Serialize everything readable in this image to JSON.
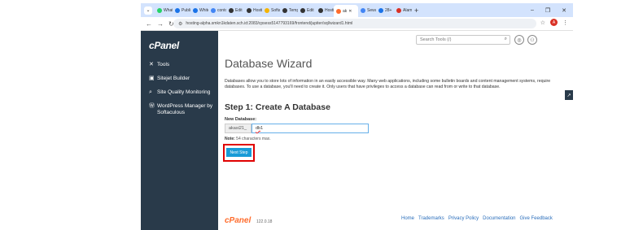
{
  "browser": {
    "tabs": [
      {
        "label": "What",
        "color": "#25d366"
      },
      {
        "label": "Publi",
        "color": "#1a73e8"
      },
      {
        "label": "White",
        "color": "#1a73e8"
      },
      {
        "label": "conto",
        "color": "#4285f4"
      },
      {
        "label": "Edit",
        "color": "#333333"
      },
      {
        "label": "Hosti",
        "color": "#333333"
      },
      {
        "label": "Softa",
        "color": "#f4b400"
      },
      {
        "label": "Temp",
        "color": "#333333"
      },
      {
        "label": "Edit",
        "color": "#333333"
      },
      {
        "label": "Hosti",
        "color": "#333333"
      },
      {
        "label": "ak",
        "color": "#ff6c2c",
        "active": true
      },
      {
        "label": "Sewa",
        "color": "#4285f4"
      },
      {
        "label": "28+",
        "color": "#1a73e8"
      },
      {
        "label": "Alam",
        "color": "#d93025"
      }
    ],
    "new_tab": "+",
    "window_controls": [
      "–",
      "❐",
      "✕"
    ],
    "url": "hosting-alpha.smkn1kdaten.sch.id:2083/cpsess5147793169/frontend/jupiter/sql/wizard1.html",
    "profile_initial": "A"
  },
  "sidebar": {
    "logo": "cPanel",
    "items": [
      {
        "label": "Tools",
        "icon": "tools-icon",
        "glyph": "✕"
      },
      {
        "label": "Sitejet Builder",
        "icon": "sitejet-icon",
        "glyph": "▣"
      },
      {
        "label": "Site Quality Monitoring",
        "icon": "magnifier-icon",
        "glyph": "⌕"
      },
      {
        "label": "WordPress Manager by Softaculous",
        "icon": "wordpress-icon",
        "glyph": "Ⓦ"
      }
    ]
  },
  "header": {
    "search_placeholder": "Search Tools (/)"
  },
  "main": {
    "title": "Database Wizard",
    "description": "Databases allow you to store lots of information in an easily accessible way. Many web applications, including some bulletin boards and content management systems, require databases. To use a database, you'll need to create it. Only users that have privileges to access a database can read from or write to that database.",
    "step_title": "Step 1: Create A Database",
    "field_label": "New Database:",
    "prefix": "akasi21_",
    "db_value_underlined": "db",
    "db_value_rest": "1",
    "note_label": "Note:",
    "note_text": "54 characters max.",
    "next_button": "Next Step"
  },
  "footer": {
    "logo": "cPanel",
    "version": "122.0.18",
    "links": [
      "Home",
      "Trademarks",
      "Privacy Policy",
      "Documentation",
      "Give Feedback"
    ]
  }
}
